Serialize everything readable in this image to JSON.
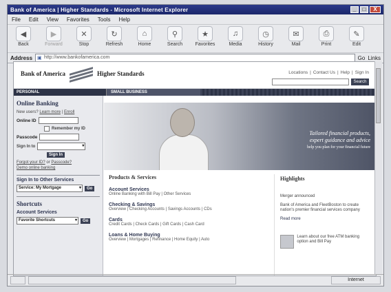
{
  "window": {
    "title": "Bank of America | Higher Standards - Microsoft Internet Explorer",
    "controls": [
      "_",
      "□",
      "X"
    ]
  },
  "menu": [
    "File",
    "Edit",
    "View",
    "Favorites",
    "Tools",
    "Help"
  ],
  "toolbar": [
    {
      "label": "Back",
      "icon": "back-icon",
      "glyph": "◀",
      "enabled": true
    },
    {
      "label": "Forward",
      "icon": "forward-icon",
      "glyph": "▶",
      "enabled": false
    },
    {
      "label": "Stop",
      "icon": "stop-icon",
      "glyph": "✕",
      "enabled": true
    },
    {
      "label": "Refresh",
      "icon": "refresh-icon",
      "glyph": "↻",
      "enabled": true
    },
    {
      "label": "Home",
      "icon": "home-icon",
      "glyph": "⌂",
      "enabled": true
    },
    {
      "label": "Search",
      "icon": "search-icon",
      "glyph": "⚲",
      "enabled": true
    },
    {
      "label": "Favorites",
      "icon": "favorites-icon",
      "glyph": "★",
      "enabled": true
    },
    {
      "label": "Media",
      "icon": "media-icon",
      "glyph": "♫",
      "enabled": true
    },
    {
      "label": "History",
      "icon": "history-icon",
      "glyph": "◷",
      "enabled": true
    },
    {
      "label": "Mail",
      "icon": "mail-icon",
      "glyph": "✉",
      "enabled": true
    },
    {
      "label": "Print",
      "icon": "print-icon",
      "glyph": "⎙",
      "enabled": true
    },
    {
      "label": "Edit",
      "icon": "edit-icon",
      "glyph": "✎",
      "enabled": true
    }
  ],
  "address": {
    "label": "Address",
    "url": "http://www.bankofamerica.com",
    "go_label": "Go",
    "links_label": "Links"
  },
  "site": {
    "logo_text": "Bank of America",
    "tagline": "Higher Standards",
    "toplinks": [
      "Locations",
      "Contact Us",
      "Help",
      "Sign In"
    ],
    "search_button": "Search",
    "nav": {
      "personal": "PERSONAL",
      "small_business": "SMALL BUSINESS"
    }
  },
  "online_banking": {
    "title": "Online Banking",
    "new_user_text": "New users?",
    "learn_more": "Learn more",
    "enroll": "Enroll",
    "id_label": "Online ID",
    "remember_label": "Remember my ID",
    "passcode_label": "Passcode",
    "signin_label": "Sign In",
    "sign_in_to": "Sign In to",
    "forgot_link": "Forgot your ID?",
    "passcode_link": "Passcode?",
    "demo_link": "Demo online banking"
  },
  "other_services": {
    "title": "Sign In to Other Services",
    "selected": "Service: My Mortgage",
    "go_label": "Go"
  },
  "shortcuts": {
    "title": "Shortcuts",
    "subtitle": "Account Services",
    "selected": "Favorite Shortcuts",
    "go_label": "Go"
  },
  "hero": {
    "line1": "Tailored financial products,",
    "line2": "expert guidance and advice",
    "line3": "help you plan for your financial future"
  },
  "products": {
    "title": "Products & Services",
    "items": [
      {
        "heading": "Account Services",
        "sub": "Online Banking with Bill Pay | Other Services"
      },
      {
        "heading": "Checking & Savings",
        "sub": "Overview | Checking Accounts | Savings Accounts | CDs"
      },
      {
        "heading": "Cards",
        "sub": "Credit Cards | Check Cards | Gift Cards | Cash Card"
      },
      {
        "heading": "Loans & Home Buying",
        "sub": "Overview | Mortgages | Refinance | Home Equity | Auto"
      }
    ]
  },
  "highlights": {
    "title": "Highlights",
    "merger_title": "Merger announced",
    "merger_text": "Bank of America and FleetBoston to create nation's premier financial services company",
    "more": "Read more",
    "promo_text": "Learn about our free ATM banking option and Bill Pay"
  },
  "status": {
    "zone": "Internet"
  }
}
